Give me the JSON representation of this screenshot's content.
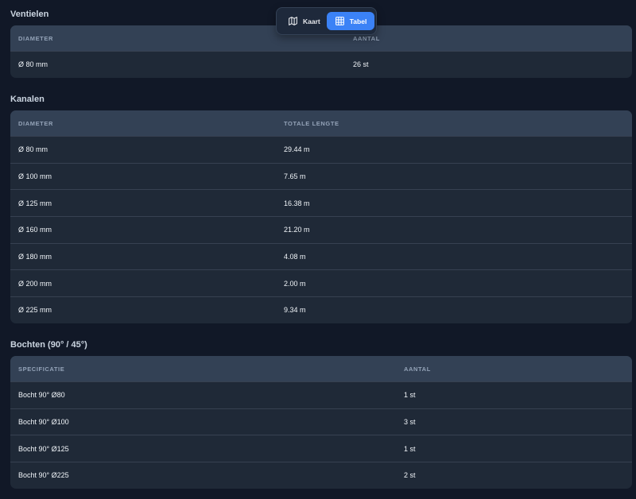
{
  "toggle": {
    "kaart_label": "Kaart",
    "tabel_label": "Tabel",
    "active": "Tabel",
    "active_color": "#3b82f6"
  },
  "ventielen": {
    "title": "Ventielen",
    "headers": [
      "DIAMETER",
      "AANTAL"
    ],
    "rows": [
      [
        "Ø 80 mm",
        "26 st"
      ]
    ]
  },
  "kanalen": {
    "title": "Kanalen",
    "headers": [
      "DIAMETER",
      "TOTALE LENGTE"
    ],
    "rows": [
      [
        "Ø 80 mm",
        "29.44 m"
      ],
      [
        "Ø 100 mm",
        "7.65 m"
      ],
      [
        "Ø 125 mm",
        "16.38 m"
      ],
      [
        "Ø 160 mm",
        "21.20 m"
      ],
      [
        "Ø 180 mm",
        "4.08 m"
      ],
      [
        "Ø 200 mm",
        "2.00 m"
      ],
      [
        "Ø 225 mm",
        "9.34 m"
      ]
    ]
  },
  "bochten": {
    "title": "Bochten (90° / 45°)",
    "headers": [
      "SPECIFICATIE",
      "AANTAL"
    ],
    "rows": [
      [
        "Bocht 90° Ø80",
        "1 st"
      ],
      [
        "Bocht 90° Ø100",
        "3 st"
      ],
      [
        "Bocht 90° Ø125",
        "1 st"
      ],
      [
        "Bocht 90° Ø225",
        "2 st"
      ]
    ]
  }
}
